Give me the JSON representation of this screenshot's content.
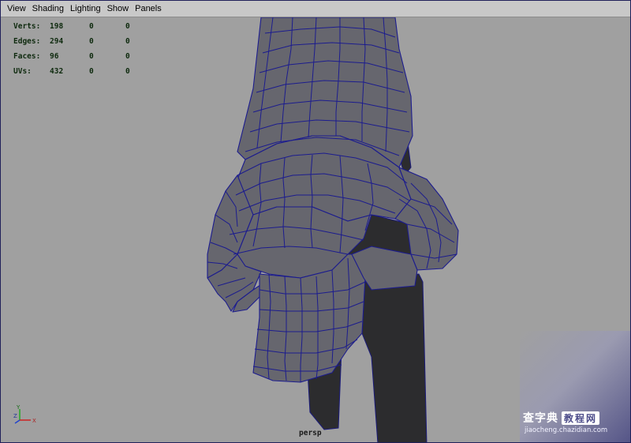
{
  "menu": {
    "items": [
      "View",
      "Shading",
      "Lighting",
      "Show",
      "Panels"
    ]
  },
  "hud": {
    "rows": [
      {
        "label": "Verts:",
        "values": [
          "198",
          "0",
          "0"
        ]
      },
      {
        "label": "Edges:",
        "values": [
          "294",
          "0",
          "0"
        ]
      },
      {
        "label": "Faces:",
        "values": [
          "96",
          "0",
          "0"
        ]
      },
      {
        "label": "UVs:",
        "values": [
          "432",
          "0",
          "0"
        ]
      }
    ]
  },
  "viewport": {
    "camera_label": "persp",
    "background_color": "#a0a0a0",
    "mesh_face_color": "#62626a",
    "mesh_wire_color": "#1a1a8c",
    "dark_part_color": "#2c2c2e"
  },
  "axis": {
    "y_label": "Y",
    "z_label": "Z",
    "x_label": "X"
  },
  "watermark": {
    "title": "查字典",
    "badge": "教程网",
    "url": "jiaocheng.chazidian.com"
  }
}
